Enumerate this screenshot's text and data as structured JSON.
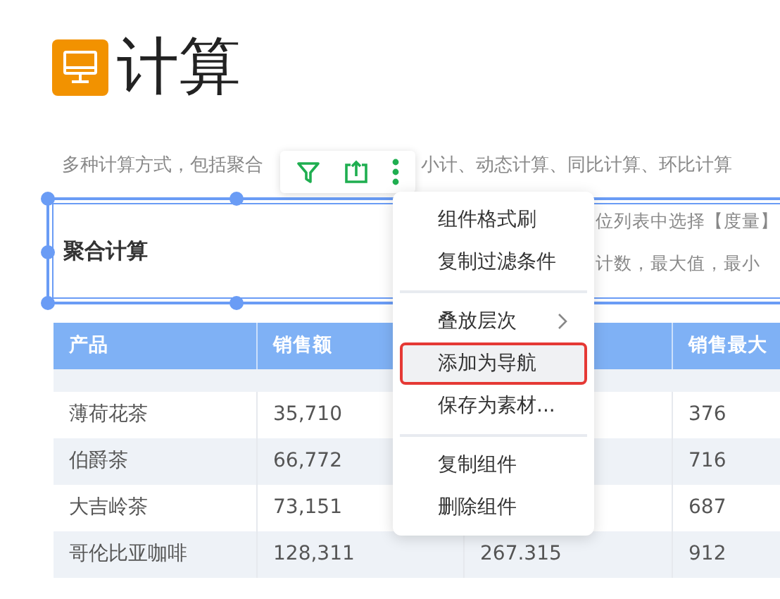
{
  "page": {
    "title": "计算",
    "description_parts": [
      "多种计算方式，包括聚合",
      "小计、动态计算、同比计算、环比计算"
    ]
  },
  "component": {
    "title": "聚合计算",
    "text_lines": [
      "位列表中选择【度量】",
      "计数，最大值，最小"
    ]
  },
  "toolbar": {
    "buttons": [
      {
        "kind": "filter"
      },
      {
        "kind": "export"
      },
      {
        "kind": "more"
      }
    ]
  },
  "table": {
    "columns": [
      "产品",
      "销售额",
      "销售最大"
    ],
    "rows": [
      {
        "product": "薄荷花茶",
        "sales": "35,710",
        "max": "376"
      },
      {
        "product": "伯爵茶",
        "sales": "66,772",
        "max": "716"
      },
      {
        "product": "大吉岭茶",
        "sales": "73,151",
        "max": "687"
      },
      {
        "product": "哥伦比亚咖啡",
        "sales": "128,311",
        "column_3": "267.315",
        "max": "912"
      }
    ]
  },
  "context_menu": {
    "groups": [
      [
        {
          "label": "组件格式刷",
          "submenu": false,
          "selected": false
        },
        {
          "label": "复制过滤条件",
          "submenu": false,
          "selected": false
        }
      ],
      [
        {
          "label": "叠放层次",
          "submenu": true,
          "selected": false
        },
        {
          "label": "添加为导航",
          "submenu": false,
          "selected": true
        },
        {
          "label": "保存为素材...",
          "submenu": false,
          "selected": false
        }
      ],
      [
        {
          "label": "复制组件",
          "submenu": false,
          "selected": false
        },
        {
          "label": "删除组件",
          "submenu": false,
          "selected": false
        }
      ]
    ]
  }
}
